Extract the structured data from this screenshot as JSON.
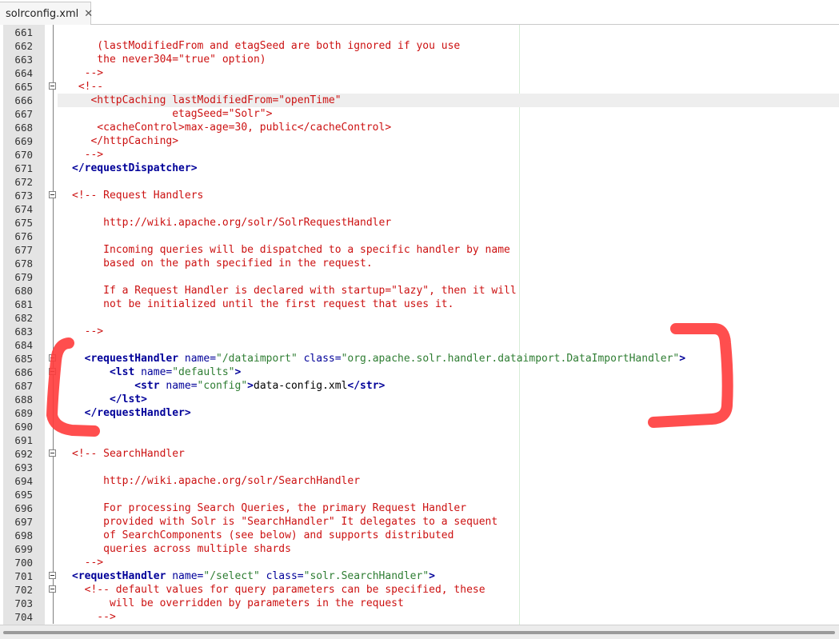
{
  "tab": {
    "title": "solrconfig.xml",
    "close": "✕"
  },
  "colors": {
    "comment": "#cc1111",
    "tag": "#000099",
    "value": "#2e7d32",
    "annotation": "#ff3b3b"
  },
  "lines": [
    {
      "n": "661",
      "s": []
    },
    {
      "n": "662",
      "s": [
        {
          "t": "    (lastModifiedFrom and etagSeed are both ignored if you use",
          "c": "cm"
        }
      ]
    },
    {
      "n": "663",
      "s": [
        {
          "t": "    the never304=\"true\" option)",
          "c": "cm"
        }
      ]
    },
    {
      "n": "664",
      "s": [
        {
          "t": "  -->",
          "c": "cm"
        }
      ]
    },
    {
      "n": "665",
      "fold": true,
      "s": [
        {
          "t": " <!--",
          "c": "cm"
        }
      ]
    },
    {
      "n": "666",
      "current": true,
      "s": [
        {
          "t": "   <httpCaching lastModifiedFrom=\"openTime\"",
          "c": "cm"
        }
      ]
    },
    {
      "n": "667",
      "s": [
        {
          "t": "                etagSeed=\"Solr\">",
          "c": "cm"
        }
      ]
    },
    {
      "n": "668",
      "s": [
        {
          "t": "    <cacheControl>max-age=30, public</cacheControl>",
          "c": "cm"
        }
      ]
    },
    {
      "n": "669",
      "s": [
        {
          "t": "   </httpCaching>",
          "c": "cm"
        }
      ]
    },
    {
      "n": "670",
      "s": [
        {
          "t": "  -->",
          "c": "cm"
        }
      ]
    },
    {
      "n": "671",
      "s": [
        {
          "t": "</requestDispatcher>",
          "c": "tag"
        }
      ]
    },
    {
      "n": "672",
      "s": []
    },
    {
      "n": "673",
      "fold": true,
      "s": [
        {
          "t": "<!-- Request Handlers",
          "c": "cm"
        }
      ]
    },
    {
      "n": "674",
      "s": []
    },
    {
      "n": "675",
      "s": [
        {
          "t": "     http://wiki.apache.org/solr/SolrRequestHandler",
          "c": "cm"
        }
      ]
    },
    {
      "n": "676",
      "s": []
    },
    {
      "n": "677",
      "s": [
        {
          "t": "     Incoming queries will be dispatched to a specific handler by name",
          "c": "cm"
        }
      ]
    },
    {
      "n": "678",
      "s": [
        {
          "t": "     based on the path specified in the request.",
          "c": "cm"
        }
      ]
    },
    {
      "n": "679",
      "s": []
    },
    {
      "n": "680",
      "s": [
        {
          "t": "     If a Request Handler is declared with startup=\"lazy\", then it will",
          "c": "cm"
        }
      ]
    },
    {
      "n": "681",
      "s": [
        {
          "t": "     not be initialized until the first request that uses it.",
          "c": "cm"
        }
      ]
    },
    {
      "n": "682",
      "s": []
    },
    {
      "n": "683",
      "s": [
        {
          "t": "  -->",
          "c": "cm"
        }
      ]
    },
    {
      "n": "684",
      "s": []
    },
    {
      "n": "685",
      "fold": true,
      "s": [
        {
          "t": "  <requestHandler ",
          "c": "tag"
        },
        {
          "t": "name=",
          "c": "attr"
        },
        {
          "t": "\"/dataimport\"",
          "c": "val"
        },
        {
          "t": " class=",
          "c": "attr"
        },
        {
          "t": "\"org.apache.solr.handler.dataimport.DataImportHandler\"",
          "c": "val"
        },
        {
          "t": ">",
          "c": "tag"
        }
      ]
    },
    {
      "n": "686",
      "fold": true,
      "s": [
        {
          "t": "      <lst ",
          "c": "tag"
        },
        {
          "t": "name=",
          "c": "attr"
        },
        {
          "t": "\"defaults\"",
          "c": "val"
        },
        {
          "t": ">",
          "c": "tag"
        }
      ]
    },
    {
      "n": "687",
      "s": [
        {
          "t": "          <str ",
          "c": "tag"
        },
        {
          "t": "name=",
          "c": "attr"
        },
        {
          "t": "\"config\"",
          "c": "val"
        },
        {
          "t": ">",
          "c": "tag"
        },
        {
          "t": "data-config.xml",
          "c": "txt"
        },
        {
          "t": "</str>",
          "c": "tag"
        }
      ]
    },
    {
      "n": "688",
      "s": [
        {
          "t": "      </lst>",
          "c": "tag"
        }
      ]
    },
    {
      "n": "689",
      "s": [
        {
          "t": "  </requestHandler>",
          "c": "tag"
        }
      ]
    },
    {
      "n": "690",
      "s": []
    },
    {
      "n": "691",
      "s": []
    },
    {
      "n": "692",
      "fold": true,
      "s": [
        {
          "t": "<!-- SearchHandler",
          "c": "cm"
        }
      ]
    },
    {
      "n": "693",
      "s": []
    },
    {
      "n": "694",
      "s": [
        {
          "t": "     http://wiki.apache.org/solr/SearchHandler",
          "c": "cm"
        }
      ]
    },
    {
      "n": "695",
      "s": []
    },
    {
      "n": "696",
      "s": [
        {
          "t": "     For processing Search Queries, the primary Request Handler",
          "c": "cm"
        }
      ]
    },
    {
      "n": "697",
      "s": [
        {
          "t": "     provided with Solr is \"SearchHandler\" It delegates to a sequent",
          "c": "cm"
        }
      ]
    },
    {
      "n": "698",
      "s": [
        {
          "t": "     of SearchComponents (see below) and supports distributed",
          "c": "cm"
        }
      ]
    },
    {
      "n": "699",
      "s": [
        {
          "t": "     queries across multiple shards",
          "c": "cm"
        }
      ]
    },
    {
      "n": "700",
      "s": [
        {
          "t": "  -->",
          "c": "cm"
        }
      ]
    },
    {
      "n": "701",
      "fold": true,
      "s": [
        {
          "t": "<requestHandler ",
          "c": "tag"
        },
        {
          "t": "name=",
          "c": "attr"
        },
        {
          "t": "\"/select\"",
          "c": "val"
        },
        {
          "t": " class=",
          "c": "attr"
        },
        {
          "t": "\"solr.SearchHandler\"",
          "c": "val"
        },
        {
          "t": ">",
          "c": "tag"
        }
      ]
    },
    {
      "n": "702",
      "fold": true,
      "s": [
        {
          "t": "  <!-- default values for query parameters can be specified, these",
          "c": "cm"
        }
      ]
    },
    {
      "n": "703",
      "s": [
        {
          "t": "      will be overridden by parameters in the request",
          "c": "cm"
        }
      ]
    },
    {
      "n": "704",
      "s": [
        {
          "t": "    -->",
          "c": "cm"
        }
      ]
    }
  ]
}
